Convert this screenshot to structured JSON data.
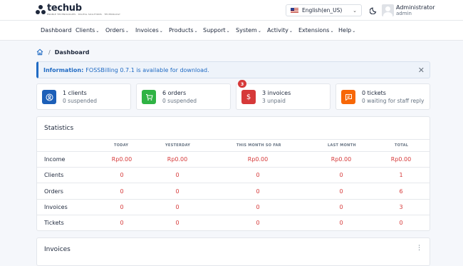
{
  "brand": {
    "name": "techub",
    "tagline": "ENABLE TECHNOLOGIES · DIGITAL SOLUTIONS · TECHNOLOGY"
  },
  "language": {
    "selected": "English(en_US)"
  },
  "user": {
    "name": "Administrator",
    "role": "admin"
  },
  "nav": [
    "Dashboard",
    "Clients",
    "Orders",
    "Invoices",
    "Products",
    "Support",
    "System",
    "Activity",
    "Extensions",
    "Help"
  ],
  "breadcrumb": {
    "current": "Dashboard"
  },
  "alert": {
    "label": "Information:",
    "text": "FOSSBilling 0.7.1 is available for download."
  },
  "cards": {
    "clients": {
      "line1": "1 clients",
      "line2": "0 suspended",
      "color": "#1c5fb8"
    },
    "orders": {
      "line1": "6 orders",
      "line2": "0 suspended",
      "color": "#2fb344"
    },
    "invoices": {
      "line1": "3 invoices",
      "line2": "3 unpaid",
      "badge": "3",
      "color": "#d63939"
    },
    "tickets": {
      "line1": "0 tickets",
      "line2": "0 waiting for staff reply",
      "color": "#f76707"
    }
  },
  "statistics": {
    "title": "Statistics",
    "columns": [
      "TODAY",
      "YESTERDAY",
      "THIS MONTH SO FAR",
      "LAST MONTH",
      "TOTAL"
    ],
    "rows": [
      {
        "label": "Income",
        "values": [
          "Rp0.00",
          "Rp0.00",
          "Rp0.00",
          "Rp0.00",
          "Rp0.00"
        ]
      },
      {
        "label": "Clients",
        "values": [
          "0",
          "0",
          "0",
          "0",
          "1"
        ]
      },
      {
        "label": "Orders",
        "values": [
          "0",
          "0",
          "0",
          "0",
          "6"
        ]
      },
      {
        "label": "Invoices",
        "values": [
          "0",
          "0",
          "0",
          "0",
          "3"
        ]
      },
      {
        "label": "Tickets",
        "values": [
          "0",
          "0",
          "0",
          "0",
          "0"
        ]
      }
    ]
  },
  "invoices_panel": {
    "title": "Invoices"
  },
  "colors": {
    "accent": "#206bc4",
    "value_red": "#d63939"
  }
}
